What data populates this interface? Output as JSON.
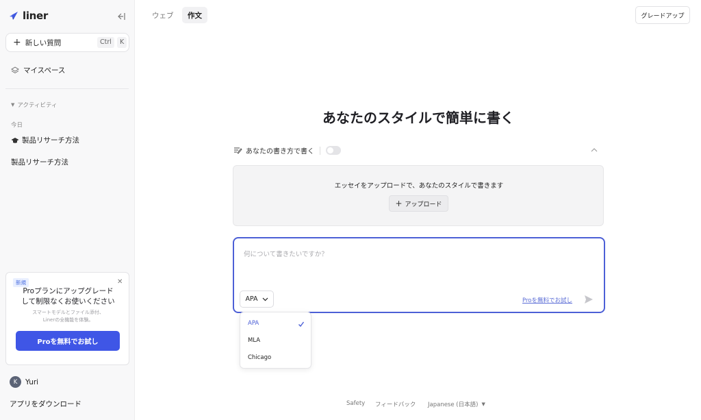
{
  "sidebar": {
    "logo_text": "liner",
    "new_question_label": "新しい質問",
    "shortcut_ctrl": "Ctrl",
    "shortcut_key": "K",
    "myspace_label": "マイスペース",
    "activity_label": "アクティビティ",
    "today_label": "今日",
    "history": [
      "製品リサーチ方法",
      "製品リサーチ方法"
    ],
    "promo": {
      "badge": "新規",
      "title_line1": "Proプランにアップグレード",
      "title_line2": "して制限なくお使いください",
      "sub_line1": "スマートモデルとファイル添付、",
      "sub_line2": "Linerの全機能を体験。",
      "cta": "Proを無料でお試し"
    },
    "user_initial": "K",
    "user_name": "Yuri",
    "download_label": "アプリをダウンロード"
  },
  "header": {
    "tabs": [
      {
        "label": "ウェブ"
      },
      {
        "label": "作文"
      }
    ],
    "upgrade_label": "グレードアップ"
  },
  "main": {
    "headline": "あなたのスタイルで簡単に書く",
    "style_toggle_label": "あなたの書き方で書く",
    "upload_message": "エッセイをアップロードで、あなたのスタイルで書きます",
    "upload_button": "アップロード",
    "prompt_placeholder": "何について書きたいですか？",
    "selected_style": "APA",
    "pro_link": "Proを無料でお試し",
    "style_options": [
      "APA",
      "MLA",
      "Chicago"
    ]
  },
  "footer": {
    "safety": "Safety",
    "feedback": "フィードバック",
    "language": "Japanese (日本語)"
  },
  "colors": {
    "accent": "#4c5fd6",
    "cta": "#3f56e6"
  }
}
